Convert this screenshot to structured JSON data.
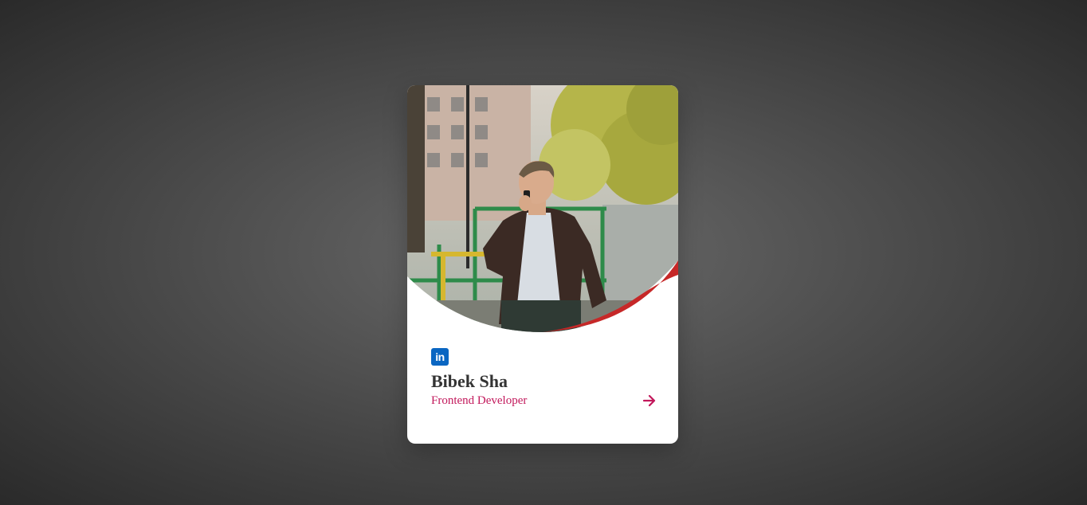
{
  "card": {
    "photo_alt": "person-on-phone-photo",
    "social_icon": "linkedin-icon",
    "social_label": "in",
    "name": "Bibek Sha",
    "role": "Frontend Developer",
    "action_icon": "arrow-right-icon"
  },
  "colors": {
    "background": "#4d4d4d",
    "card": "#ffffff",
    "accent": "#c2185b",
    "wave": "#c62828",
    "linkedin": "#0a66c2",
    "name": "#333333"
  }
}
